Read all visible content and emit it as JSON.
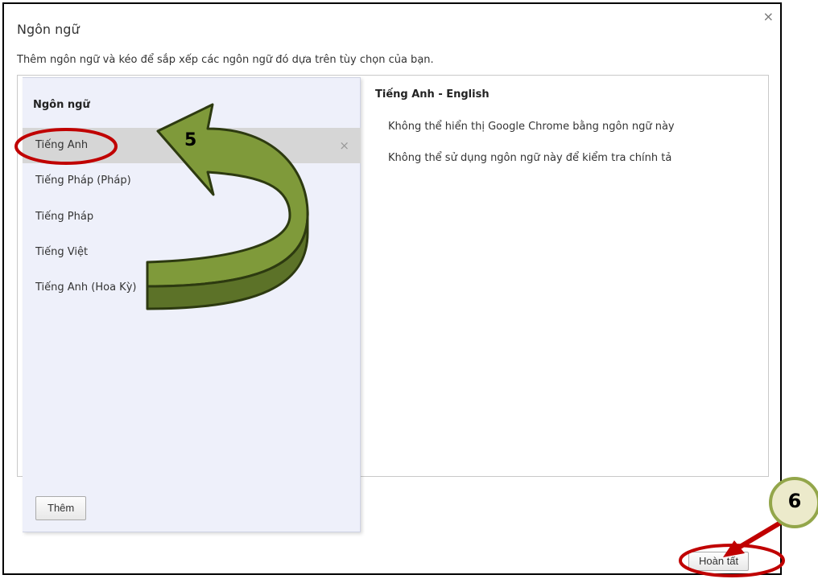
{
  "dialog": {
    "title": "Ngôn ngữ",
    "close_glyph": "×",
    "instruction": "Thêm ngôn ngữ và kéo để sắp xếp các ngôn ngữ đó dựa trên tùy chọn của bạn."
  },
  "languages": {
    "heading": "Ngôn ngữ",
    "items": [
      {
        "label": "Tiếng Anh",
        "selected": true
      },
      {
        "label": "Tiếng Pháp (Pháp)",
        "selected": false
      },
      {
        "label": "Tiếng Pháp",
        "selected": false
      },
      {
        "label": "Tiếng Việt",
        "selected": false
      },
      {
        "label": "Tiếng Anh (Hoa Kỳ)",
        "selected": false
      }
    ],
    "remove_glyph": "×",
    "add_button": "Thêm"
  },
  "details": {
    "title": "Tiếng Anh - English",
    "line1": "Không thể hiển thị Google Chrome bằng ngôn ngữ này",
    "line2": "Không thể sử dụng ngôn ngữ này để kiểm tra chính tả"
  },
  "footer": {
    "done_button": "Hoàn tất"
  },
  "annotations": {
    "step5": "5",
    "step6": "6",
    "arrow_color": "#7f9a3a",
    "marker_color": "#c00000"
  }
}
